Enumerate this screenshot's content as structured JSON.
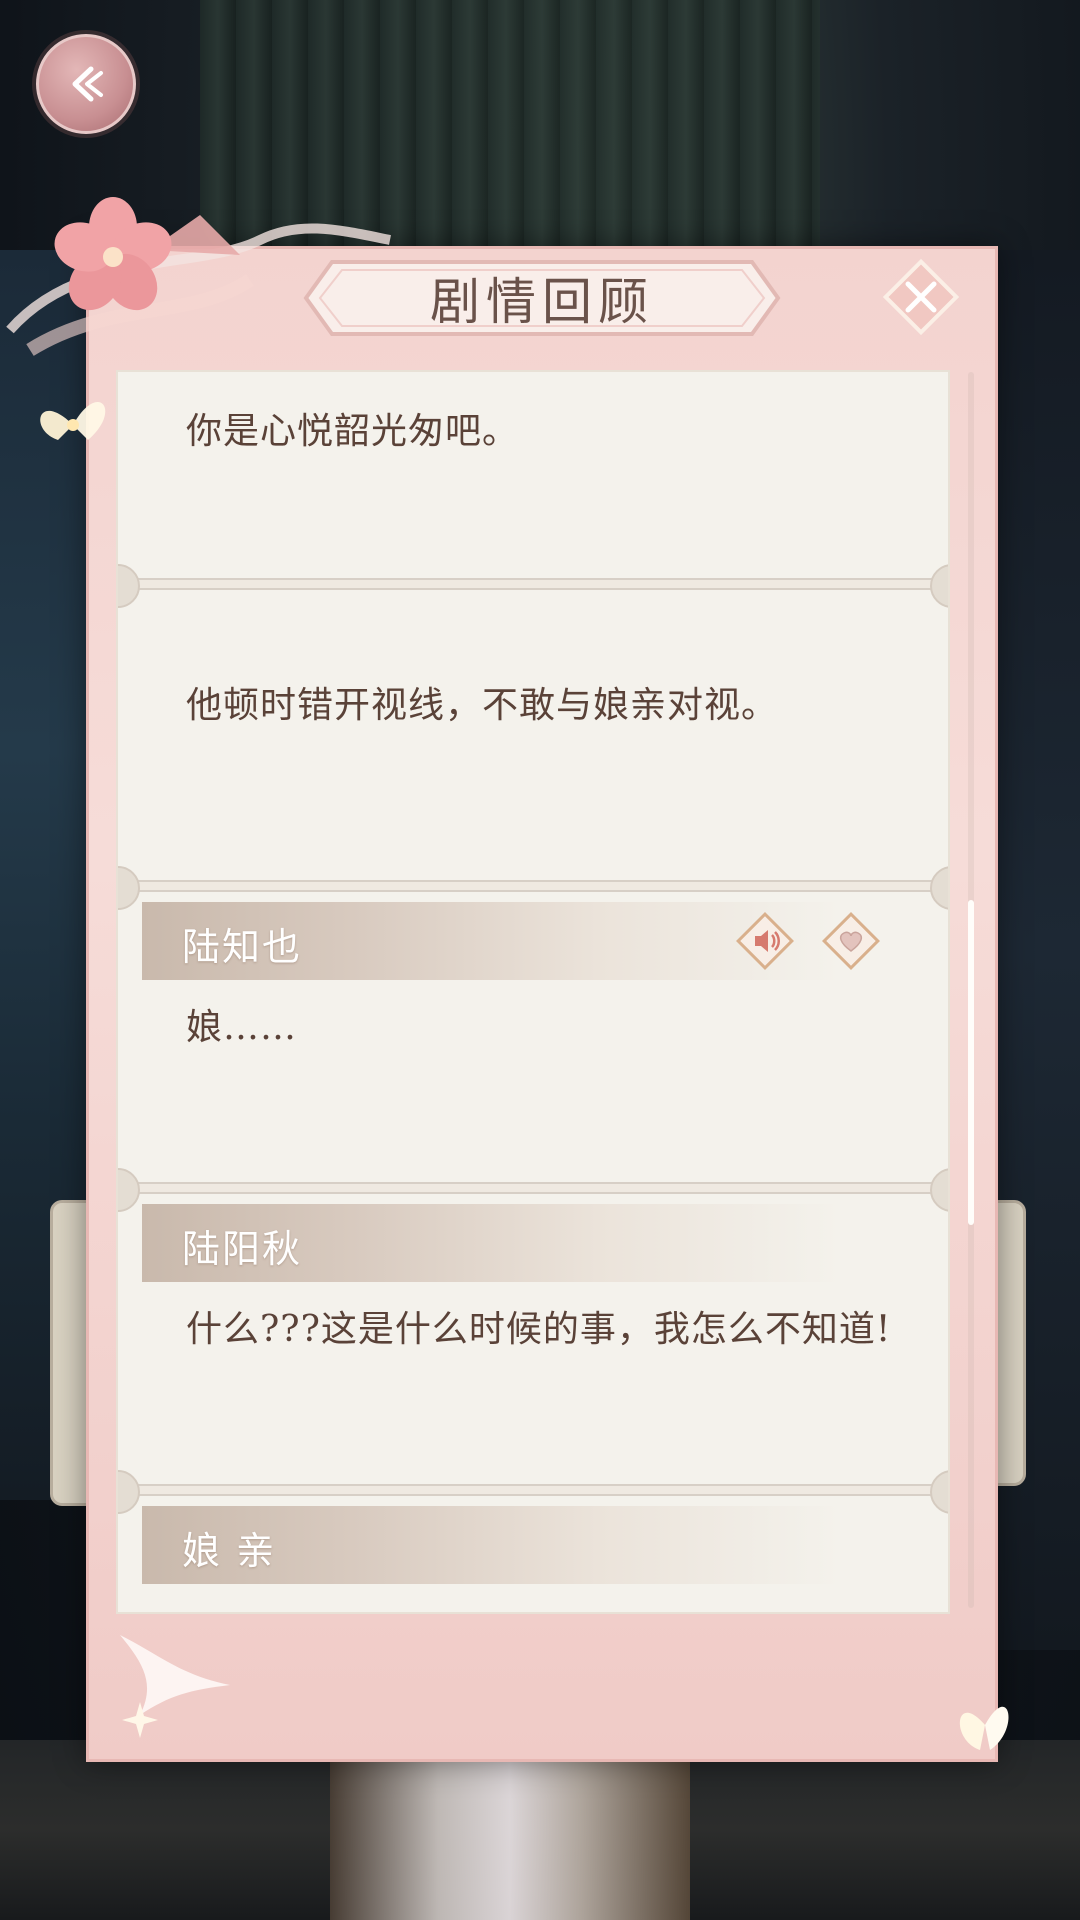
{
  "header": {
    "title": "剧情回顾"
  },
  "icons": {
    "back": "back-arrow-icon",
    "close": "close-icon",
    "voice": "speaker-icon",
    "favorite": "heart-icon"
  },
  "entries": [
    {
      "speaker": "",
      "text": "你是心悦韶光匆吧。"
    },
    {
      "speaker": "",
      "text": "他顿时错开视线，不敢与娘亲对视。"
    },
    {
      "speaker": "陆知也",
      "text": "娘……"
    },
    {
      "speaker": "陆阳秋",
      "text": "什么???这是什么时候的事，我怎么不知道!"
    },
    {
      "speaker": "娘 亲",
      "text": ""
    }
  ],
  "colors": {
    "panel": "#f3d3cf",
    "paper": "#f4f2ec",
    "text": "#5a4238",
    "accent": "#c88f92"
  }
}
